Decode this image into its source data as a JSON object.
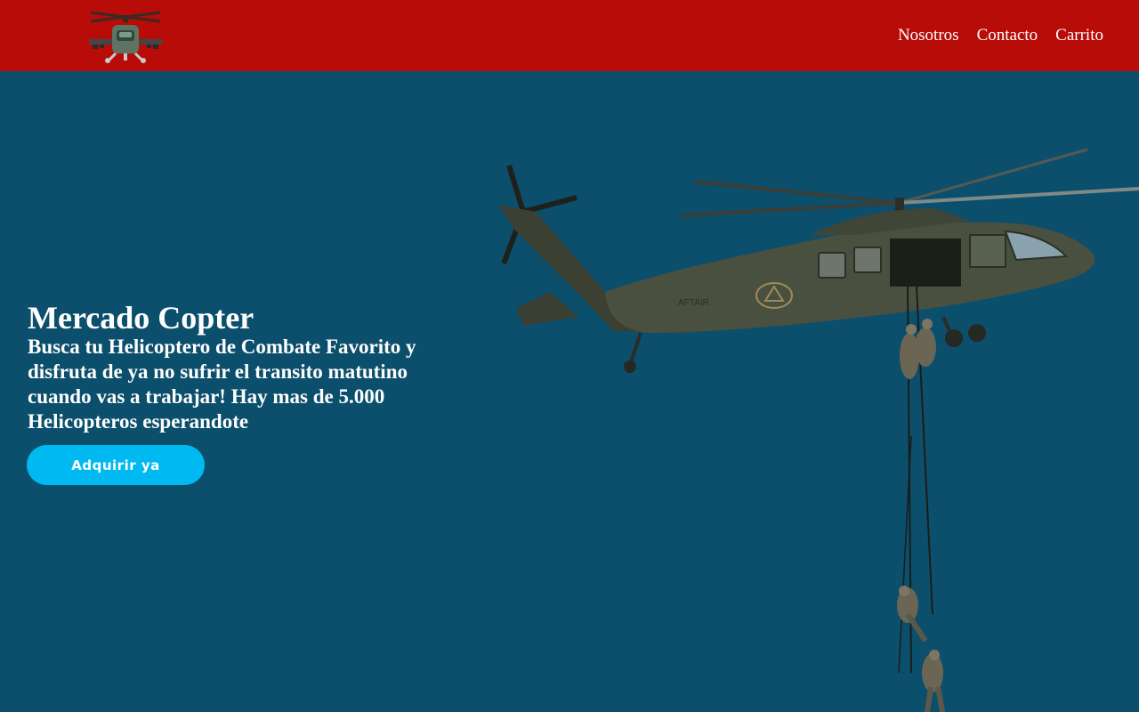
{
  "header": {
    "logo_icon": "attack-helicopter-icon",
    "nav": [
      {
        "label": "Nosotros"
      },
      {
        "label": "Contacto"
      },
      {
        "label": "Carrito"
      }
    ]
  },
  "hero": {
    "title": "Mercado Copter",
    "subtitle": "Busca tu Helicoptero de Combate Favorito y disfruta de ya no sufrir el transito matutino cuando vas a trabajar! Hay mas de 5.000 Helicopteros esperandote",
    "cta_label": "Adquirir ya",
    "image_icon": "helicopter-rappelling-soldiers-image",
    "helicopter_marking": "AFTAIR"
  },
  "colors": {
    "header_bg": "#b80c09",
    "page_bg": "#0b4f6c",
    "button_bg": "#00b9f1",
    "text": "#ffffff"
  }
}
